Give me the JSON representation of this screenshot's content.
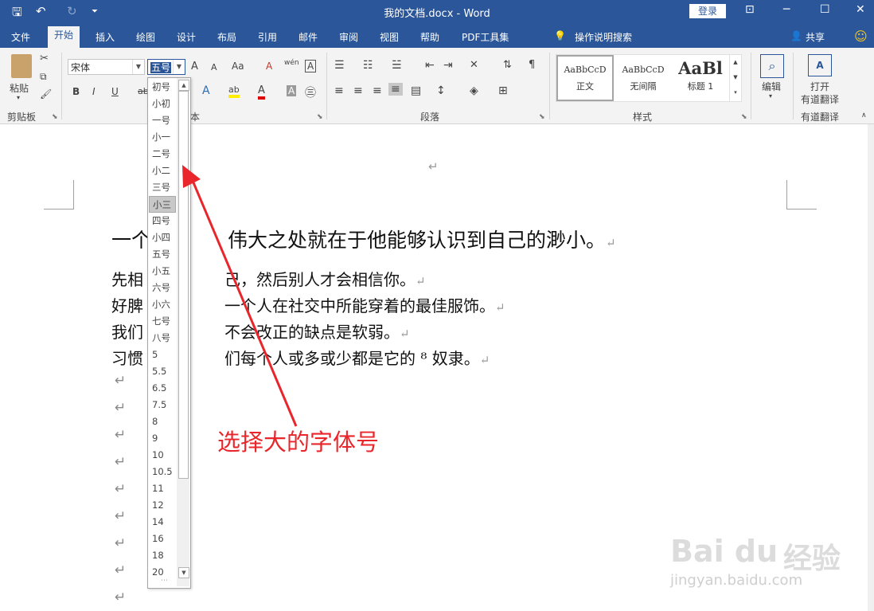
{
  "window": {
    "title": "我的文档.docx - Word",
    "login": "登录",
    "qat": {
      "save": "🖫",
      "undo": "↶",
      "redo": "↻",
      "customize": "⏷"
    },
    "controls": {
      "ribbon_display": "⊡",
      "minimize": "─",
      "maximize": "☐",
      "close": "✕"
    }
  },
  "tabs": [
    "文件",
    "开始",
    "插入",
    "绘图",
    "设计",
    "布局",
    "引用",
    "邮件",
    "审阅",
    "视图",
    "帮助",
    "PDF工具集"
  ],
  "active_tab": "开始",
  "tell_me": "操作说明搜索",
  "share": "共享",
  "ribbon": {
    "clipboard": {
      "paste": "粘贴",
      "label": "剪贴板"
    },
    "font": {
      "name": "宋体",
      "size": "五号",
      "label_fragment": "本",
      "grow": "A",
      "shrink": "A",
      "change_case": "Aa",
      "clear_format": "A",
      "phonetic": "wén",
      "border_char": "A",
      "bold": "B",
      "italic": "I",
      "underline": "U",
      "strike": "ab",
      "text_effect": "A",
      "highlight": "ab",
      "font_color": "A",
      "char_shading": "A",
      "enclose": "㊂"
    },
    "paragraph": {
      "label": "段落"
    },
    "styles": {
      "label": "样式",
      "items": [
        {
          "preview": "AaBbCcD",
          "name": "正文"
        },
        {
          "preview": "AaBbCcD",
          "name": "无间隔"
        },
        {
          "preview": "AaBl",
          "name": "标题 1"
        }
      ]
    },
    "editing": {
      "label": "编辑"
    },
    "youdao": {
      "line1": "打开",
      "line2": "有道翻译",
      "label": "有道翻译"
    }
  },
  "font_size_options": [
    "初号",
    "小初",
    "一号",
    "小一",
    "二号",
    "小二",
    "三号",
    "小三",
    "四号",
    "小四",
    "五号",
    "小五",
    "六号",
    "小六",
    "七号",
    "八号",
    "5",
    "5.5",
    "6.5",
    "7.5",
    "8",
    "9",
    "10",
    "10.5",
    "11",
    "12",
    "14",
    "16",
    "18",
    "20"
  ],
  "font_size_highlighted": "小三",
  "document": {
    "top_mark": "↵",
    "lines": [
      {
        "head": "一个",
        "tail": "伟大之处就在于他能够认识到自己的渺小。"
      },
      {
        "head": "先相",
        "tail": "己，然后别人才会相信你。"
      },
      {
        "head": "好脾",
        "tail": "一个人在社交中所能穿着的最佳服饰。"
      },
      {
        "head": "我们",
        "tail": "不会改正的缺点是软弱。"
      },
      {
        "head": "习惯",
        "tail": "们每个人或多或少都是它的 ⁸ 奴隶。"
      }
    ],
    "empty_mark": "↵"
  },
  "annotation": "选择大的字体号",
  "watermark": {
    "logo": "Bai du",
    "jingyan": "经验",
    "url": "jingyan.baidu.com"
  },
  "colors": {
    "accent": "#2b579a",
    "annotation": "#e8262b"
  }
}
